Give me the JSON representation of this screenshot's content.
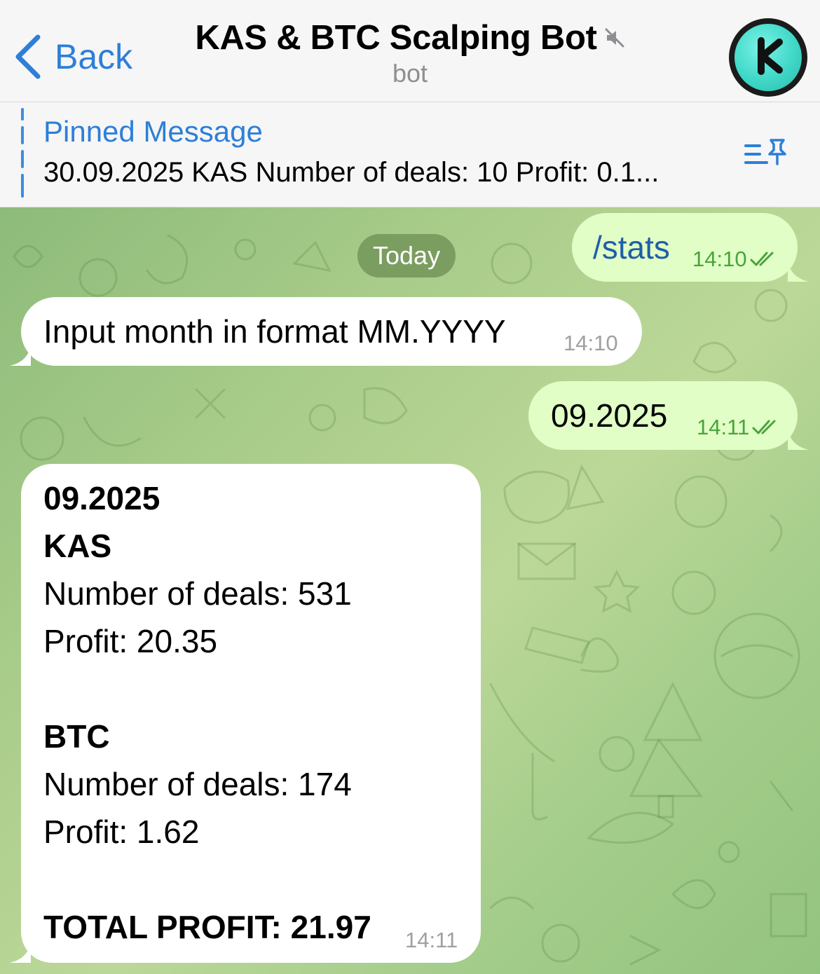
{
  "header": {
    "back_label": "Back",
    "title": "KAS & BTC Scalping Bot",
    "subtitle": "bot",
    "accent": "#2d7fd8"
  },
  "pinned": {
    "title": "Pinned Message",
    "text": "30.09.2025 KAS Number of deals: 10 Profit: 0.1..."
  },
  "date_separator": "Today",
  "messages": [
    {
      "direction": "out",
      "text": "/stats",
      "time": "14:10",
      "status": "read"
    },
    {
      "direction": "in",
      "text": "Input month in format MM.YYYY",
      "time": "14:10"
    },
    {
      "direction": "out",
      "text": "09.2025",
      "time": "14:11",
      "status": "read"
    },
    {
      "direction": "in",
      "time": "14:11",
      "stats": {
        "period": "09.2025",
        "kas_heading": "KAS",
        "kas_deals": "Number of deals: 531",
        "kas_profit": "Profit: 20.35",
        "btc_heading": "BTC",
        "btc_deals": "Number of deals: 174",
        "btc_profit": "Profit: 1.62",
        "total": "TOTAL PROFIT: 21.97"
      }
    }
  ],
  "colors": {
    "outgoing_bubble": "#e1fec6",
    "incoming_bubble": "#ffffff",
    "read_check": "#4aa33c",
    "command_link": "#1f5ea8"
  }
}
